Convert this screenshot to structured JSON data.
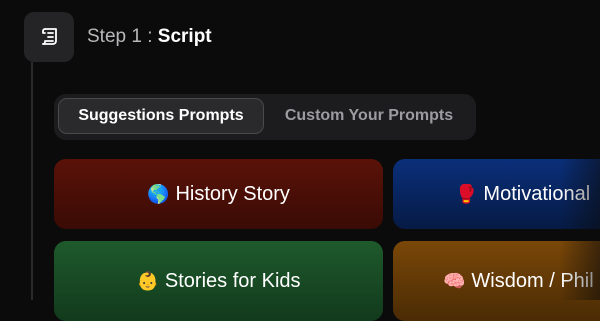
{
  "step": {
    "prefix": "Step 1 : ",
    "name": "Script",
    "icon": "scroll-icon"
  },
  "tabs": [
    {
      "label": "Suggestions Prompts",
      "active": true
    },
    {
      "label": "Custom Your Prompts",
      "active": false
    }
  ],
  "cards": [
    {
      "emoji": "🌎",
      "label": "History Story",
      "icon": "globe-icon",
      "color": "#5a1208"
    },
    {
      "emoji": "🥊",
      "label": "Motivational",
      "icon": "boxing-glove-icon",
      "color": "#0a2f7a"
    },
    {
      "emoji": "👶",
      "label": "Stories for Kids",
      "icon": "baby-icon",
      "color": "#1e5a2c"
    },
    {
      "emoji": "🧠",
      "label": "Wisdom / Phil",
      "icon": "brain-icon",
      "color": "#7a4708"
    }
  ]
}
